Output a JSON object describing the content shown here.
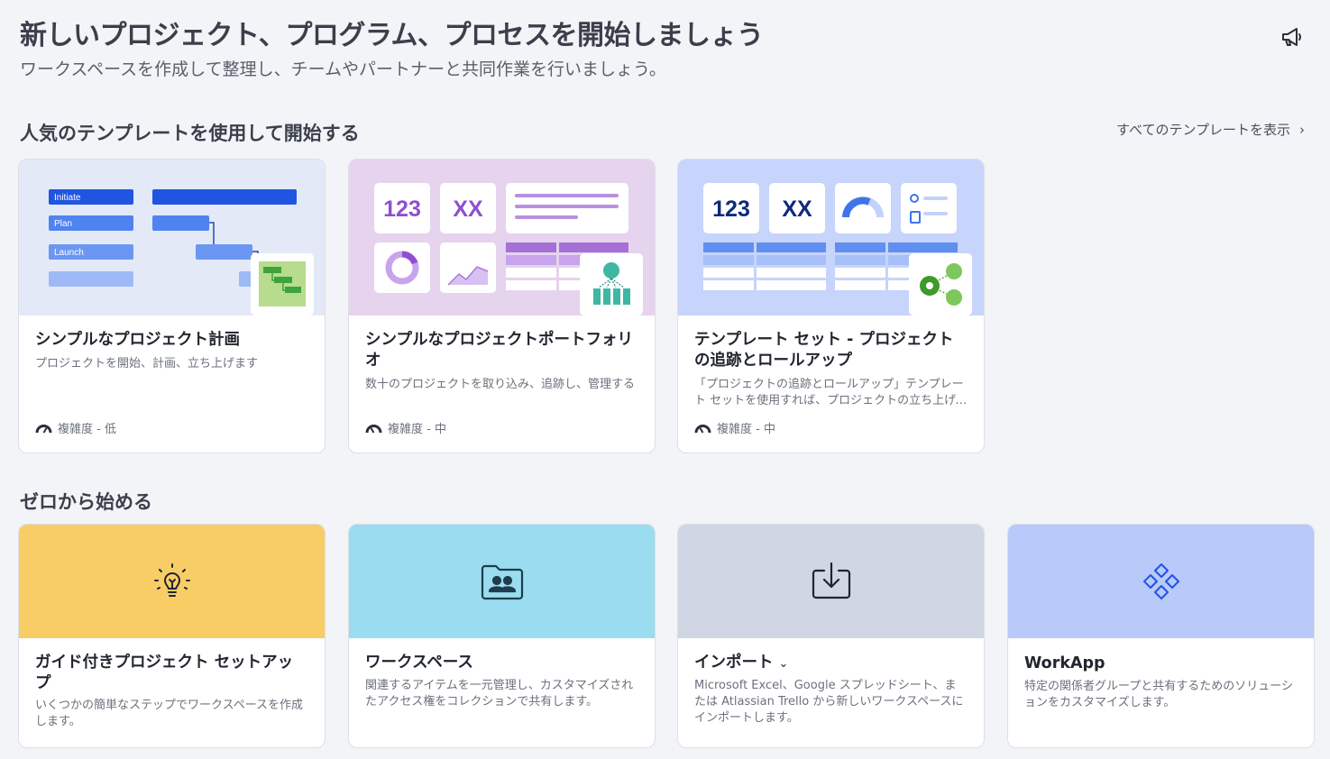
{
  "header": {
    "title": "新しいプロジェクト、プログラム、プロセスを開始しましょう",
    "subtitle": "ワークスペースを作成して整理し、チームやパートナーと共同作業を行いましょう。",
    "announce_icon": "megaphone-icon"
  },
  "templates": {
    "heading": "人気のテンプレートを使用して開始する",
    "view_all": "すべてのテンプレートを表示",
    "view_all_chevron": "›",
    "cards": [
      {
        "title": "シンプルなプロジェクト計画",
        "desc": "プロジェクトを開始、計画、立ち上げます",
        "complexity": "複雑度 - 低",
        "thumb_bg": "#e4e9f8",
        "gantt_labels": [
          "Initiate",
          "Plan",
          "Launch"
        ]
      },
      {
        "title": "シンプルなプロジェクトポートフォリオ",
        "desc": "数十のプロジェクトを取り込み、追跡し、管理する",
        "complexity": "複雑度 - 中",
        "thumb_bg": "#e6d3ee",
        "tiles": [
          "123",
          "XX"
        ]
      },
      {
        "title": "テンプレート セット - プロジェクトの追跡とロールアップ",
        "desc": "「プロジェクトの追跡とロールアップ」テンプレート セットを使用すれば、プロジェクトの立ち上げ、管理、ロールアップを簡単に行うことができます。",
        "complexity": "複雑度 - 中",
        "thumb_bg": "#c7d4fb",
        "tiles": [
          "123",
          "XX"
        ]
      }
    ]
  },
  "scratch": {
    "heading": "ゼロから始める",
    "cards": [
      {
        "title": "ガイド付きプロジェクト セットアップ",
        "desc": "いくつかの簡単なステップでワークスペースを作成します。",
        "bg": "#f8cd66",
        "icon": "lightbulb-icon"
      },
      {
        "title": "ワークスペース",
        "desc": "関連するアイテムを一元管理し、カスタマイズされたアクセス権をコレクションで共有します。",
        "bg": "#9adcf0",
        "icon": "shared-folder-icon"
      },
      {
        "title": "インポート",
        "caret": "⌄",
        "desc": "Microsoft Excel、Google スプレッドシート、または Atlassian Trello から新しいワークスペースにインポートします。",
        "bg": "#d1d6e4",
        "icon": "download-tray-icon"
      },
      {
        "title": "WorkApp",
        "desc": "特定の関係者グループと共有するためのソリューションをカスタマイズします。",
        "bg": "#b8c9fa",
        "icon": "workapp-diamonds-icon"
      }
    ]
  }
}
